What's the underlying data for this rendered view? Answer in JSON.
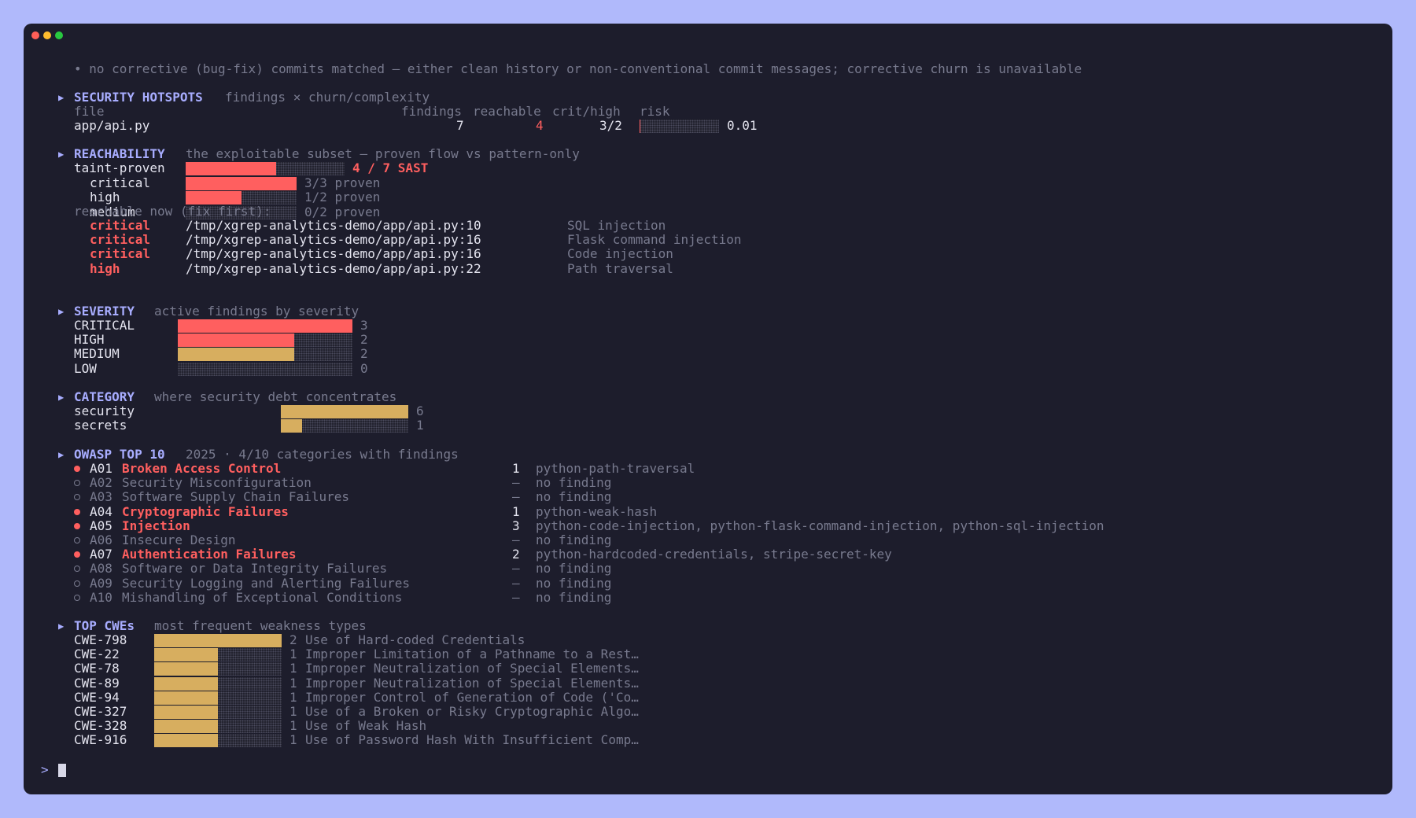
{
  "note": "• no corrective (bug-fix) commits matched — either clean history or non-conventional commit messages; corrective churn is unavailable",
  "hotspots": {
    "title": "SECURITY HOTSPOTS",
    "subtitle": "findings × churn/complexity",
    "headers": {
      "file": "file",
      "findings": "findings",
      "reachable": "reachable",
      "crit_high": "crit/high",
      "risk": "risk"
    },
    "rows": [
      {
        "file": "app/api.py",
        "findings": "7",
        "reachable": "4",
        "crit_high": "3/2",
        "risk": "0.01",
        "risk_fraction": 0.01
      }
    ]
  },
  "reachability": {
    "title": "REACHABILITY",
    "subtitle": "the exploitable subset — proven flow vs pattern-only",
    "taint": {
      "label": "taint-proven",
      "summary": "4 / 7 SAST",
      "fraction": 0.5714
    },
    "levels": [
      {
        "label": "critical",
        "text": "3/3 proven",
        "fraction": 1.0
      },
      {
        "label": "high",
        "text": "1/2 proven",
        "fraction": 0.5
      },
      {
        "label": "medium",
        "text": "0/2 proven",
        "fraction": 0.0
      }
    ],
    "fix_first_label": "reachable now (fix first):",
    "fix_first": [
      {
        "severity": "critical",
        "location": "/tmp/xgrep-analytics-demo/app/api.py:10",
        "desc": "SQL injection"
      },
      {
        "severity": "critical",
        "location": "/tmp/xgrep-analytics-demo/app/api.py:16",
        "desc": "Flask command injection"
      },
      {
        "severity": "critical",
        "location": "/tmp/xgrep-analytics-demo/app/api.py:16",
        "desc": "Code injection"
      },
      {
        "severity": "high",
        "location": "/tmp/xgrep-analytics-demo/app/api.py:22",
        "desc": "Path traversal"
      }
    ]
  },
  "severity": {
    "title": "SEVERITY",
    "subtitle": "active findings by severity",
    "max": 3,
    "rows": [
      {
        "label": "CRITICAL",
        "count": "3",
        "value": 3,
        "color": "#ff5f5f"
      },
      {
        "label": "HIGH",
        "count": "2",
        "value": 2,
        "color": "#ff5f5f"
      },
      {
        "label": "MEDIUM",
        "count": "2",
        "value": 2,
        "color": "#d7ae5f"
      },
      {
        "label": "LOW",
        "count": "0",
        "value": 0,
        "color": "#d7ae5f"
      }
    ]
  },
  "category": {
    "title": "CATEGORY",
    "subtitle": "where security debt concentrates",
    "max": 6,
    "rows": [
      {
        "label": "security",
        "count": "6",
        "value": 6
      },
      {
        "label": "secrets",
        "count": "1",
        "value": 1
      }
    ]
  },
  "owasp": {
    "title": "OWASP TOP 10",
    "subtitle": "2025 · 4/10 categories with findings",
    "rows": [
      {
        "id": "A01",
        "name": "Broken Access Control",
        "active": true,
        "count": "1",
        "detail": "python-path-traversal"
      },
      {
        "id": "A02",
        "name": "Security Misconfiguration",
        "active": false,
        "count": "–",
        "detail": "no finding"
      },
      {
        "id": "A03",
        "name": "Software Supply Chain Failures",
        "active": false,
        "count": "–",
        "detail": "no finding"
      },
      {
        "id": "A04",
        "name": "Cryptographic Failures",
        "active": true,
        "count": "1",
        "detail": "python-weak-hash"
      },
      {
        "id": "A05",
        "name": "Injection",
        "active": true,
        "count": "3",
        "detail": "python-code-injection, python-flask-command-injection, python-sql-injection"
      },
      {
        "id": "A06",
        "name": "Insecure Design",
        "active": false,
        "count": "–",
        "detail": "no finding"
      },
      {
        "id": "A07",
        "name": "Authentication Failures",
        "active": true,
        "count": "2",
        "detail": "python-hardcoded-credentials, stripe-secret-key"
      },
      {
        "id": "A08",
        "name": "Software or Data Integrity Failures",
        "active": false,
        "count": "–",
        "detail": "no finding"
      },
      {
        "id": "A09",
        "name": "Security Logging and Alerting Failures",
        "active": false,
        "count": "–",
        "detail": "no finding"
      },
      {
        "id": "A10",
        "name": "Mishandling of Exceptional Conditions",
        "active": false,
        "count": "–",
        "detail": "no finding"
      }
    ]
  },
  "cwes": {
    "title": "TOP CWEs",
    "subtitle": "most frequent weakness types",
    "max": 2,
    "rows": [
      {
        "id": "CWE-798",
        "count": "2",
        "value": 2,
        "desc": "Use of Hard-coded Credentials"
      },
      {
        "id": "CWE-22",
        "count": "1",
        "value": 1,
        "desc": "Improper Limitation of a Pathname to a Rest…"
      },
      {
        "id": "CWE-78",
        "count": "1",
        "value": 1,
        "desc": "Improper Neutralization of Special Elements…"
      },
      {
        "id": "CWE-89",
        "count": "1",
        "value": 1,
        "desc": "Improper Neutralization of Special Elements…"
      },
      {
        "id": "CWE-94",
        "count": "1",
        "value": 1,
        "desc": "Improper Control of Generation of Code ('Co…"
      },
      {
        "id": "CWE-327",
        "count": "1",
        "value": 1,
        "desc": "Use of a Broken or Risky Cryptographic Algo…"
      },
      {
        "id": "CWE-328",
        "count": "1",
        "value": 1,
        "desc": "Use of Weak Hash"
      },
      {
        "id": "CWE-916",
        "count": "1",
        "value": 1,
        "desc": "Use of Password Hash With Insufficient Comp…"
      }
    ]
  },
  "prompt": {
    "symbol": ">"
  },
  "colors": {
    "accent": "#a8adff",
    "danger": "#ff5f5f",
    "warning": "#d7ae5f",
    "background": "#1d1d2c",
    "frame": "#b0b9fb"
  }
}
